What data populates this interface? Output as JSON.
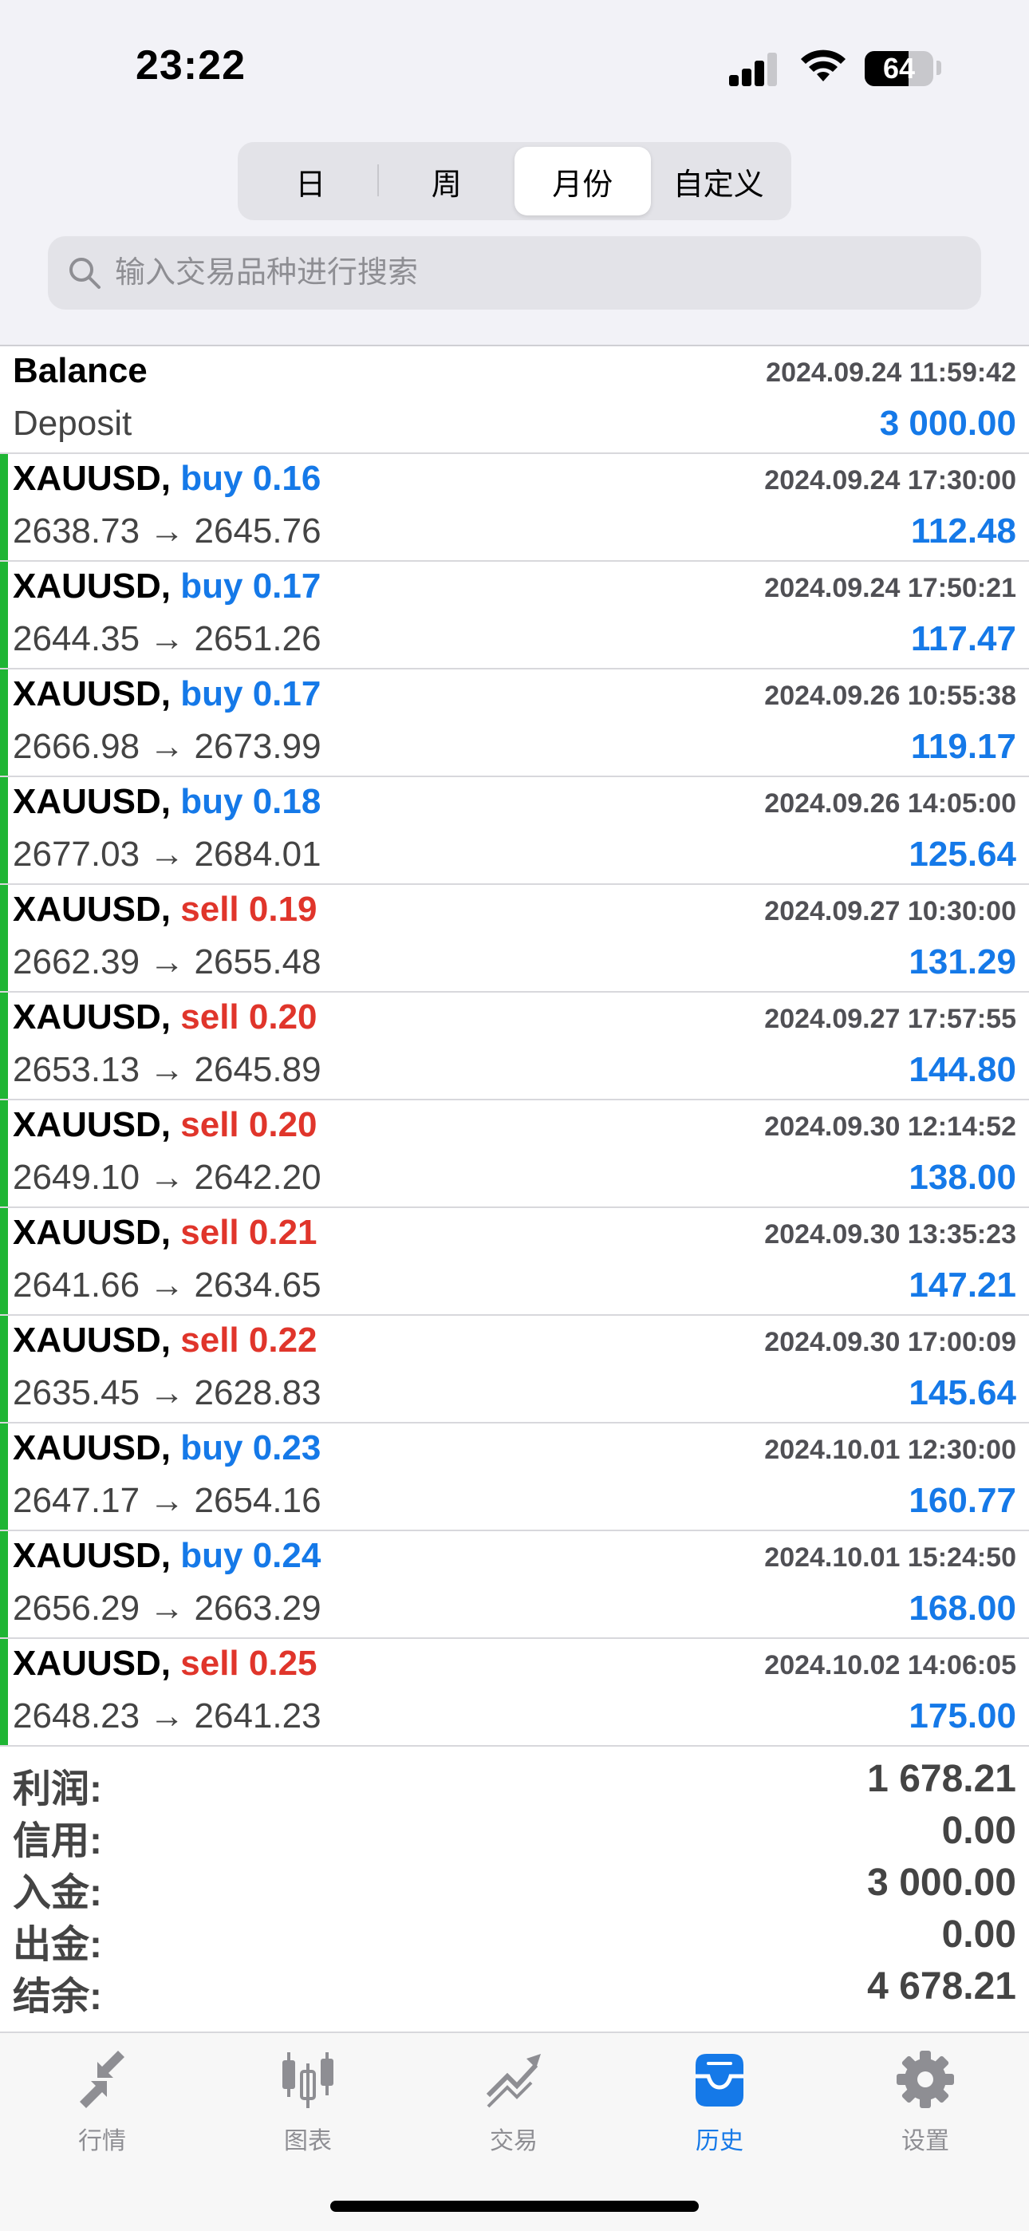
{
  "status_bar": {
    "time": "23:22",
    "battery": "64",
    "battery_level": 0.64
  },
  "period_tabs": [
    {
      "label": "日",
      "active": false
    },
    {
      "label": "周",
      "active": false
    },
    {
      "label": "月份",
      "active": true
    },
    {
      "label": "自定义",
      "active": false
    }
  ],
  "search": {
    "placeholder": "输入交易品种进行搜索",
    "value": ""
  },
  "balance": {
    "title": "Balance",
    "type": "Deposit",
    "time": "2024.09.24 11:59:42",
    "amount": "3 000.00"
  },
  "deals": [
    {
      "symbol": "XAUUSD,",
      "side": "buy 0.16",
      "dir": "buy",
      "prices": "2638.73 → 2645.76",
      "time": "2024.09.24 17:30:00",
      "profit": "112.48"
    },
    {
      "symbol": "XAUUSD,",
      "side": "buy 0.17",
      "dir": "buy",
      "prices": "2644.35 → 2651.26",
      "time": "2024.09.24 17:50:21",
      "profit": "117.47"
    },
    {
      "symbol": "XAUUSD,",
      "side": "buy 0.17",
      "dir": "buy",
      "prices": "2666.98 → 2673.99",
      "time": "2024.09.26 10:55:38",
      "profit": "119.17"
    },
    {
      "symbol": "XAUUSD,",
      "side": "buy 0.18",
      "dir": "buy",
      "prices": "2677.03 → 2684.01",
      "time": "2024.09.26 14:05:00",
      "profit": "125.64"
    },
    {
      "symbol": "XAUUSD,",
      "side": "sell 0.19",
      "dir": "sell",
      "prices": "2662.39 → 2655.48",
      "time": "2024.09.27 10:30:00",
      "profit": "131.29"
    },
    {
      "symbol": "XAUUSD,",
      "side": "sell 0.20",
      "dir": "sell",
      "prices": "2653.13 → 2645.89",
      "time": "2024.09.27 17:57:55",
      "profit": "144.80"
    },
    {
      "symbol": "XAUUSD,",
      "side": "sell 0.20",
      "dir": "sell",
      "prices": "2649.10 → 2642.20",
      "time": "2024.09.30 12:14:52",
      "profit": "138.00"
    },
    {
      "symbol": "XAUUSD,",
      "side": "sell 0.21",
      "dir": "sell",
      "prices": "2641.66 → 2634.65",
      "time": "2024.09.30 13:35:23",
      "profit": "147.21"
    },
    {
      "symbol": "XAUUSD,",
      "side": "sell 0.22",
      "dir": "sell",
      "prices": "2635.45 → 2628.83",
      "time": "2024.09.30 17:00:09",
      "profit": "145.64"
    },
    {
      "symbol": "XAUUSD,",
      "side": "buy 0.23",
      "dir": "buy",
      "prices": "2647.17 → 2654.16",
      "time": "2024.10.01 12:30:00",
      "profit": "160.77"
    },
    {
      "symbol": "XAUUSD,",
      "side": "buy 0.24",
      "dir": "buy",
      "prices": "2656.29 → 2663.29",
      "time": "2024.10.01 15:24:50",
      "profit": "168.00"
    },
    {
      "symbol": "XAUUSD,",
      "side": "sell 0.25",
      "dir": "sell",
      "prices": "2648.23 → 2641.23",
      "time": "2024.10.02 14:06:05",
      "profit": "175.00"
    }
  ],
  "summary": [
    {
      "label": "利润:",
      "value": "1 678.21"
    },
    {
      "label": "信用:",
      "value": "0.00"
    },
    {
      "label": "入金:",
      "value": "3 000.00"
    },
    {
      "label": "出金:",
      "value": "0.00"
    },
    {
      "label": "结余:",
      "value": "4 678.21"
    }
  ],
  "tabbar": [
    {
      "label": "行情",
      "icon": "quotes-icon",
      "active": false
    },
    {
      "label": "图表",
      "icon": "chart-icon",
      "active": false
    },
    {
      "label": "交易",
      "icon": "trade-icon",
      "active": false
    },
    {
      "label": "历史",
      "icon": "history-icon",
      "active": true
    },
    {
      "label": "设置",
      "icon": "settings-icon",
      "active": false
    }
  ],
  "colors": {
    "buy": "#1579e8",
    "sell": "#e0352b",
    "profit_bar": "#1fb534",
    "active_tab": "#1579e8"
  }
}
